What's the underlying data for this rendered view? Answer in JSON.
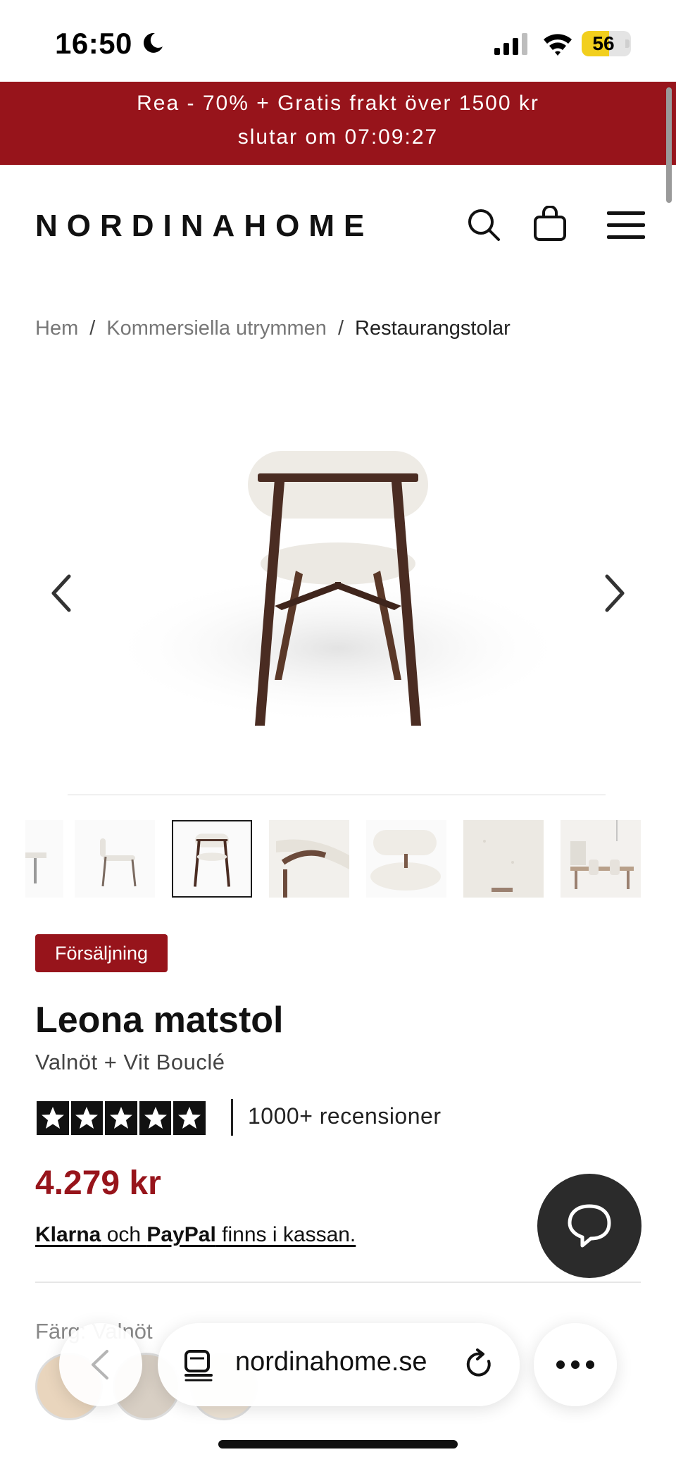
{
  "status_bar": {
    "time": "16:50",
    "battery": "56",
    "battery_level": 0.56
  },
  "promo": {
    "line1": "Rea - 70% + Gratis frakt över 1500 kr",
    "line2": "slutar om  07:09:27",
    "background_color": "#97141b"
  },
  "header": {
    "logo": "NORDINAHOME",
    "icons": [
      "search-icon",
      "shopping-bag-icon",
      "menu-icon"
    ]
  },
  "breadcrumb": {
    "items": [
      "Hem",
      "Kommersiella utrymmen",
      "Restaurangstolar"
    ],
    "separator": "/"
  },
  "gallery": {
    "thumbnail_count": 7,
    "active_index": 2
  },
  "product": {
    "badge": "Försäljning",
    "title": "Leona matstol",
    "variant": "Valnöt + Vit Bouclé",
    "rating_stars": 5,
    "review_count": "1000+ recensioner",
    "price": "4.279 kr",
    "payment_klarna": "Klarna",
    "payment_and": " och ",
    "payment_paypal": "PayPal",
    "payment_rest": " finns i kassan.",
    "color_label": "Färg: Valnöt",
    "price_color": "#97141b"
  },
  "browser": {
    "url": "nordinahome.se"
  }
}
